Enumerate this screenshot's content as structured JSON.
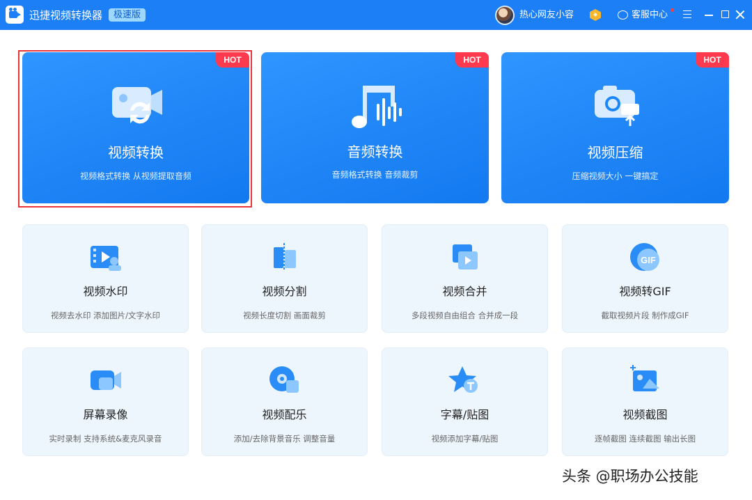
{
  "titlebar": {
    "app_title": "迅捷视频转换器",
    "edition": "极速版",
    "username": "热心网友小容",
    "service": "客服中心"
  },
  "colors": {
    "titlebar_bg": "#1d7ff5",
    "card_blue": "#1a86fa",
    "hot_badge": "#ff3a4e",
    "tool_card_bg": "#eef6fd",
    "selection_border": "#e8333b"
  },
  "featured": [
    {
      "icon": "video-convert-icon",
      "badge": "HOT",
      "title": "视频转换",
      "subtitle": "视频格式转换 从视频提取音频",
      "selected": true
    },
    {
      "icon": "audio-convert-icon",
      "badge": "HOT",
      "title": "音频转换",
      "subtitle": "音频格式转换 音频裁剪"
    },
    {
      "icon": "video-compress-icon",
      "badge": "HOT",
      "title": "视频压缩",
      "subtitle": "压缩视频大小 一键搞定"
    }
  ],
  "tools": [
    {
      "icon": "watermark-icon",
      "title": "视频水印",
      "subtitle": "视频去水印 添加图片/文字水印"
    },
    {
      "icon": "split-icon",
      "title": "视频分割",
      "subtitle": "视频长度切割 画面裁剪"
    },
    {
      "icon": "merge-icon",
      "title": "视频合并",
      "subtitle": "多段视频自由组合 合并成一段"
    },
    {
      "icon": "gif-icon",
      "title": "视频转GIF",
      "subtitle": "截取视频片段 制作成GIF"
    },
    {
      "icon": "screen-record-icon",
      "title": "屏幕录像",
      "subtitle": "实时录制 支持系统&麦克风录音"
    },
    {
      "icon": "music-icon",
      "title": "视频配乐",
      "subtitle": "添加/去除背景音乐 调整音量"
    },
    {
      "icon": "subtitle-icon",
      "title": "字幕/贴图",
      "subtitle": "视频添加字幕/贴图"
    },
    {
      "icon": "screenshot-icon",
      "title": "视频截图",
      "subtitle": "逐帧截图 连续截图 输出长图"
    }
  ],
  "gif_label": "GIF",
  "watermark": "头条 @职场办公技能"
}
